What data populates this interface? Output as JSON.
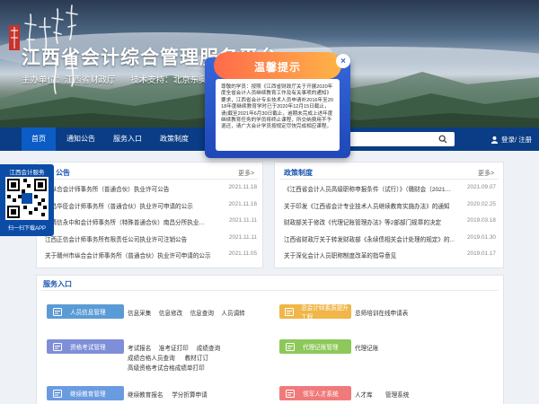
{
  "header": {
    "site_title": "江西省会计综合管理服务平台",
    "sponsor": "主办单位：江西省财政厅",
    "tech_support": "技术支持：北京东奥华宇国"
  },
  "nav": {
    "items": [
      "首页",
      "通知公告",
      "服务入口",
      "政策制度"
    ],
    "active": "首页",
    "login": "登录/ 注册"
  },
  "notices": {
    "title": "公告",
    "more": "更多>",
    "rows": [
      {
        "text": "市纵合会计师事务所（普通合伙）执业许可公告",
        "date": "2021.11.18"
      },
      {
        "text": "南昌华臣会计师事务所（普通合伙）执业许可申请的公示",
        "date": "2021.11.16"
      },
      {
        "text": "申请信永中和会计师事务所（特殊普通合伙）南昌分所执业…",
        "date": "2021.11.11"
      },
      {
        "text": "江西正信会计师事务所有限责任公司执业许可注销公告",
        "date": "2021.11.11"
      },
      {
        "text": "关于赣州市纵合会计师事务所（普通合伙）执业许可申请的公示",
        "date": "2021.11.05"
      }
    ]
  },
  "policies": {
    "title": "政策制度",
    "more": "更多>",
    "rows": [
      {
        "text": "《江西省会计人员高级职称申报条件（试行）》（赣财会〔2021…",
        "date": "2021.09.07"
      },
      {
        "text": "关于印发《江西省会计专业技术人员继续教育实施办法》的通知",
        "date": "2020.02.25"
      },
      {
        "text": "财政部关于修改《代理记账管理办法》等2部部门规章的决定",
        "date": "2019.03.18"
      },
      {
        "text": "江西省财政厅关于转发财政部《永续债相关会计处理的规定》的…",
        "date": "2019.01.30"
      },
      {
        "text": "关于深化会计人员职称制度改革的指导意见",
        "date": "2019.01.17"
      }
    ]
  },
  "services": {
    "title": "服务入口",
    "left": [
      {
        "label": "人员信息管理",
        "color": "#5b9bd5",
        "icon": "id-card-icon",
        "links": [
          "信息采集",
          "信息修改",
          "信息查询",
          "人员调转"
        ]
      },
      {
        "label": "资格考试管理",
        "color": "#7e8ed8",
        "icon": "exam-icon",
        "links": [
          "考试报名",
          "准考证打印",
          "成绩查询",
          "成绩合格人员查询",
          "教材订订",
          "高级资格考试合格成绩单打印"
        ]
      },
      {
        "label": "继续教育管理",
        "color": "#6a9be0",
        "icon": "book-icon",
        "links": [
          "继续教育报名",
          "学分折算申请"
        ]
      }
    ],
    "right": [
      {
        "label": "总会计师素质提升工程",
        "color": "#f0b64a",
        "icon": "cap-icon",
        "links": [
          "总师培训在线申请表"
        ]
      },
      {
        "label": "代理记账管理",
        "color": "#8dc85a",
        "icon": "ledger-icon",
        "links": [
          "代理记账"
        ]
      },
      {
        "label": "领军人才系统",
        "color": "#f07a7a",
        "icon": "talent-icon",
        "links": [
          "人才库",
          "管理系统"
        ]
      }
    ]
  },
  "qr": {
    "title": "江西会计服务",
    "caption": "扫一扫下载APP"
  },
  "modal": {
    "title": "温馨提示",
    "text": "尊敬的学员：按照《江西省财政厅关于开展2020年度全省会计人员继续教育工作及有关事项的通知》要求，江西省会计专业技术人员申请补2016年至2018年度继续教育学时已于2020年12月15日截止，请(截至2021年6月30日截止，逾期未完成上述年度继续教育任务的学员将终止课程，所交纳费用不予退还，请广大会计学员按规定尽快完成相应课程。"
  },
  "colors": {
    "nav_bg": "#0a3d86",
    "nav_active": "#0c5cc5",
    "accent": "#1a56b0"
  }
}
